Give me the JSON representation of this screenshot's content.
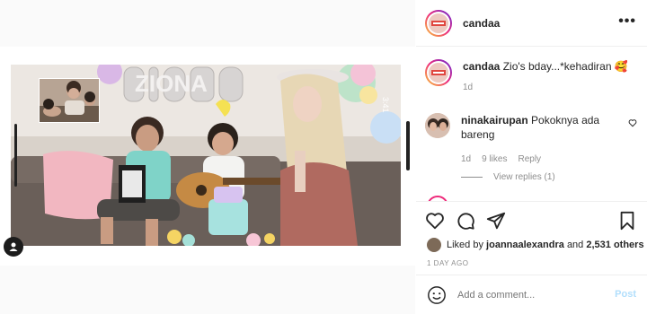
{
  "post": {
    "username": "candaa",
    "more_label": "•••",
    "caption": {
      "username": "candaa",
      "text": "Zio's bday...*kehadiran 🥰",
      "age": "1d"
    },
    "comment": {
      "username": "ninakairupan",
      "text": "Pokoknya ada bareng",
      "age": "1d",
      "likes": "9 likes",
      "reply_label": "Reply",
      "view_replies": "View replies (1)"
    },
    "likes": {
      "prefix": "Liked by",
      "user": "joannaalexandra",
      "connector": "and",
      "count": "2,531 others"
    },
    "timestamp": "1 DAY AGO",
    "add_comment": {
      "placeholder": "Add a comment...",
      "post_label": "Post"
    }
  },
  "video": {
    "balloon_text": "ZIONA",
    "corner_text": "3:41"
  },
  "colors": {
    "link_blue_disabled": "#b2dffc",
    "muted": "#8e8e8e",
    "text": "#262626",
    "story_ring_start": "#f9ce34",
    "story_ring_mid": "#ee2a7b",
    "story_ring_end": "#6228d7"
  },
  "icons": [
    "more-horizontal-icon",
    "heart-icon",
    "comment-icon",
    "share-icon",
    "bookmark-icon",
    "emoji-icon",
    "pip-icon"
  ]
}
